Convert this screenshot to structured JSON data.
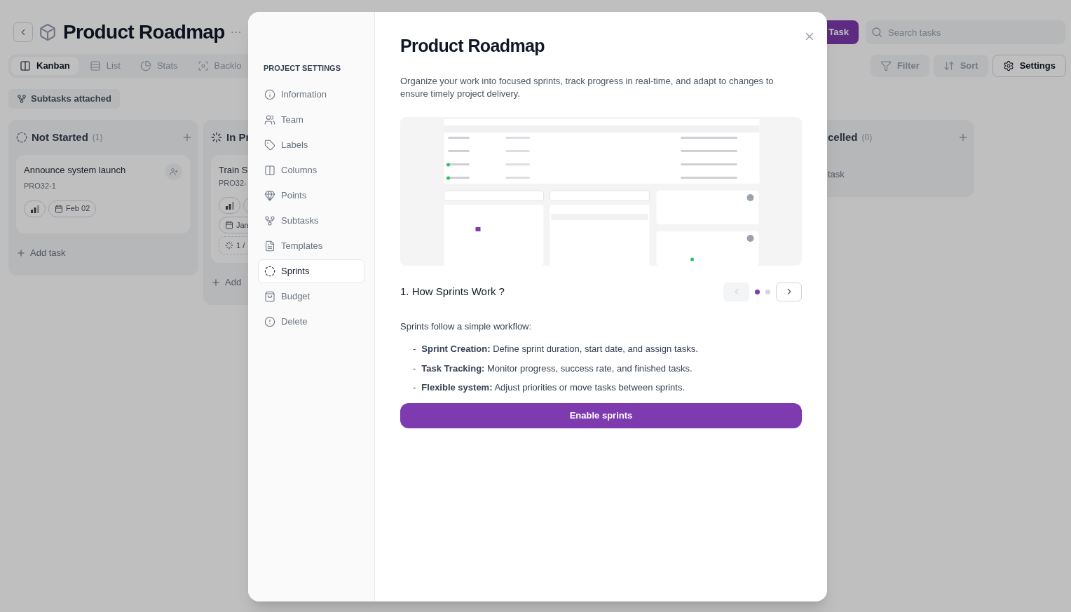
{
  "app": {
    "title": "Product Roadmap",
    "more_button": "···",
    "new_task_button": "Task",
    "search": {
      "placeholder": "Search tasks"
    },
    "views": [
      {
        "label": "Kanban",
        "kind": "kanban",
        "selected": true
      },
      {
        "label": "List",
        "kind": "list",
        "selected": false
      },
      {
        "label": "Stats",
        "kind": "stats",
        "selected": false
      },
      {
        "label": "Backlo",
        "kind": "backlog",
        "selected": false
      }
    ],
    "toolbar": [
      {
        "label": "Filter",
        "kind": "filter",
        "selected": false
      },
      {
        "label": "Sort",
        "kind": "sort",
        "selected": false
      },
      {
        "label": "Settings",
        "kind": "settings",
        "selected": true
      }
    ],
    "filter_chip": "Subtasks attached",
    "columns": [
      {
        "title": "Not Started",
        "count": "(1)",
        "kind": "not_started",
        "add_button": true,
        "add_icon": true,
        "add": "Add task",
        "tasks": [
          {
            "title": "Announce system launch",
            "key": "PRO32-1",
            "assignee_button": true,
            "chips": [
              {
                "kind": "priority"
              },
              {
                "kind": "date",
                "text": "Feb 02"
              }
            ]
          }
        ]
      },
      {
        "title": "In Pr",
        "kind": "in_progress",
        "add_button": false,
        "add_icon": true,
        "add": "Add",
        "tasks": [
          {
            "title": "Train S",
            "key": "PRO32-",
            "assignee_button": false,
            "chips": [
              {
                "kind": "priority"
              },
              {
                "kind": "label"
              },
              {
                "kind": "date",
                "text": "Jan"
              },
              {
                "kind": "progress",
                "text": "1 /"
              }
            ]
          }
        ]
      },
      {
        "title": "celled",
        "count": "(0)",
        "add_button": true,
        "add_icon": false,
        "add": "task"
      }
    ]
  },
  "settings_dialog": {
    "sidebar_heading": "PROJECT SETTINGS",
    "items": [
      {
        "label": "Information",
        "kind": "information",
        "selected": false
      },
      {
        "label": "Team",
        "kind": "team",
        "selected": false
      },
      {
        "label": "Labels",
        "kind": "labels",
        "selected": false
      },
      {
        "label": "Columns",
        "kind": "columns",
        "selected": false
      },
      {
        "label": "Points",
        "kind": "points",
        "selected": false
      },
      {
        "label": "Subtasks",
        "kind": "subtasks",
        "selected": false
      },
      {
        "label": "Templates",
        "kind": "templates",
        "selected": false
      },
      {
        "label": "Sprints",
        "kind": "sprints",
        "selected": true
      },
      {
        "label": "Budget",
        "kind": "budget",
        "selected": false
      },
      {
        "label": "Delete",
        "kind": "delete",
        "selected": false
      }
    ],
    "title": "Product Roadmap",
    "description": "Organize your work into focused sprints, track progress in real-time, and adapt to changes to ensure timely project delivery.",
    "step_title": "1. How Sprints Work ?",
    "pager": {
      "prev_disabled": true,
      "dots": [
        {
          "selected": true
        },
        {
          "selected": false
        }
      ]
    },
    "intro": "Sprints follow a simple workflow:",
    "points": [
      {
        "marker": "-",
        "text": "**Sprint Creation:** Define sprint duration, start date, and assign tasks."
      },
      {
        "marker": "-",
        "text": "**Task Tracking:** Monitor progress, success rate, and finished tasks."
      },
      {
        "marker": "-",
        "text": "**Flexible system:** Adjust priorities or move tasks between sprints."
      }
    ],
    "button": "Enable sprints"
  }
}
